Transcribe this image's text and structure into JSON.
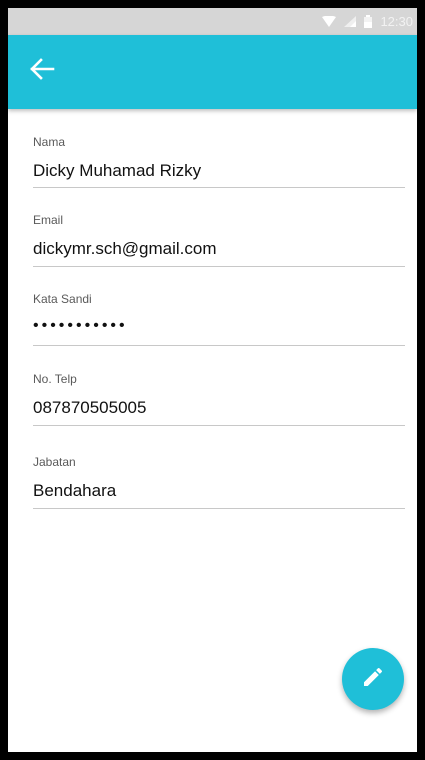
{
  "status_bar": {
    "time": "12:30",
    "icons": [
      "wifi-icon",
      "signal-icon",
      "battery-icon"
    ]
  },
  "app_bar": {
    "back_icon": "arrow-left-icon",
    "color": "#1fbfd8"
  },
  "profile": {
    "fields": [
      {
        "label": "Nama",
        "value": "Dicky Muhamad Rizky"
      },
      {
        "label": "Email",
        "value": "dickymr.sch@gmail.com"
      },
      {
        "label": "Kata Sandi",
        "value": "•••••••••••"
      },
      {
        "label": "No. Telp",
        "value": "087870505005"
      },
      {
        "label": "Jabatan",
        "value": "Bendahara"
      }
    ]
  },
  "fab": {
    "icon": "pencil-icon",
    "color": "#1fbfd8"
  }
}
